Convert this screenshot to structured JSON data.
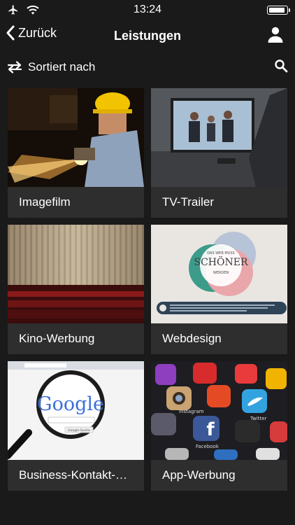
{
  "status": {
    "time": "13:24",
    "battery_level": 0.9
  },
  "nav": {
    "back_label": "Zurück",
    "title": "Leistungen"
  },
  "sort": {
    "label": "Sortiert nach"
  },
  "tiles": [
    {
      "label": "Imagefilm"
    },
    {
      "label": "TV-Trailer"
    },
    {
      "label": "Kino-Werbung"
    },
    {
      "label": "Webdesign",
      "image_text": {
        "line1": "DAS WEB MUSS",
        "line2": "SCHÖNER",
        "line3": "WERDEN"
      }
    },
    {
      "label": "Business-Kontakt-…",
      "image_text": {
        "brand": "Google",
        "button": "Google-Suche"
      }
    },
    {
      "label": "App-Werbung",
      "image_text": {
        "a": "Instagram",
        "b": "Facebook",
        "c": "Twitter"
      }
    }
  ],
  "colors": {
    "background": "#1a1a1a",
    "tile": "#2e2e2e",
    "text": "#ffffff"
  }
}
